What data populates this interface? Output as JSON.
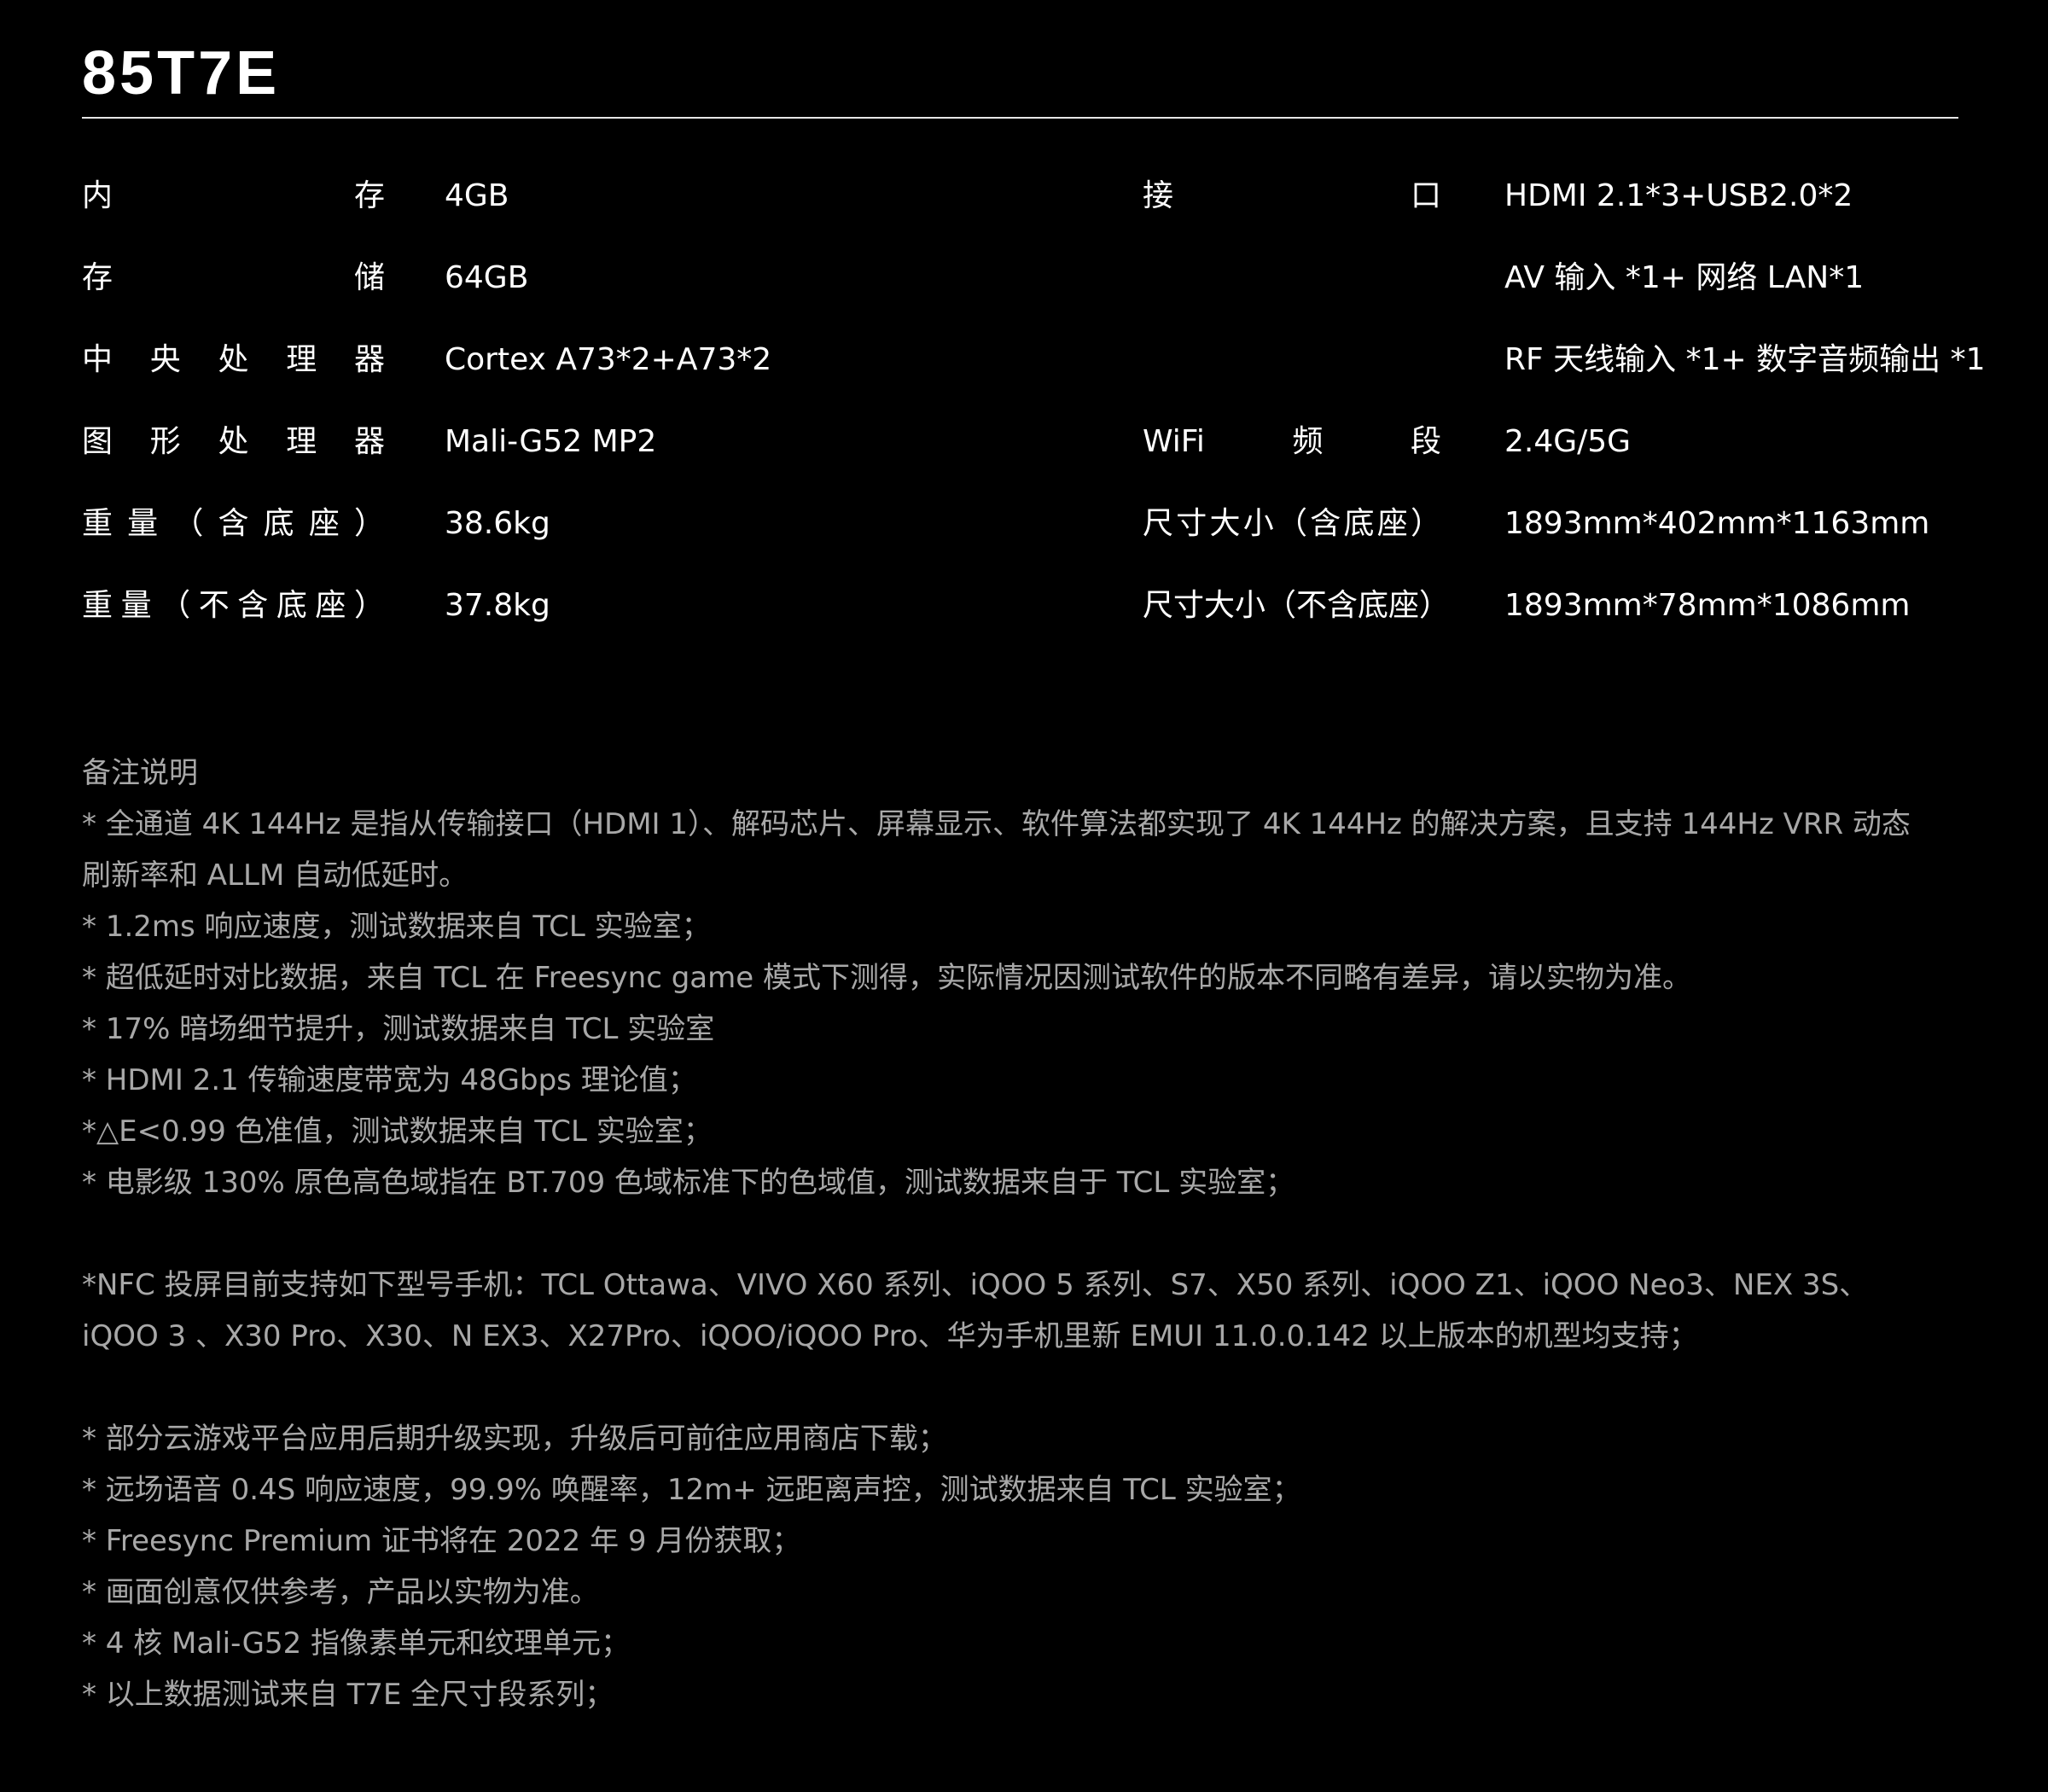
{
  "model": "85T7E",
  "specs_left": [
    {
      "label": "内存",
      "value": "4GB"
    },
    {
      "label": "存储",
      "value": "64GB"
    },
    {
      "label": "中央处理器",
      "value": "Cortex A73*2+A73*2"
    },
    {
      "label": "图形处理器",
      "value": "Mali-G52 MP2"
    },
    {
      "label": "重量（含底座）",
      "value": "38.6kg"
    },
    {
      "label": "重量（不含底座）",
      "value": "37.8kg"
    }
  ],
  "specs_right": [
    {
      "label": "接口",
      "value": "HDMI 2.1*3+USB2.0*2"
    },
    {
      "label": "",
      "value": "AV 输入 *1+ 网络 LAN*1"
    },
    {
      "label": "",
      "value": "RF 天线输入 *1+ 数字音频输出 *1"
    },
    {
      "label": "WiFi频段",
      "value": "2.4G/5G"
    },
    {
      "label": "尺寸大小（含底座）",
      "value": "1893mm*402mm*1163mm"
    },
    {
      "label": "尺寸大小（不含底座）",
      "value": "1893mm*78mm*1086mm"
    }
  ],
  "notes": {
    "heading": "备注说明",
    "group1": [
      "* 全通道 4K 144Hz 是指从传输接口（HDMI 1）、解码芯片、屏幕显示、软件算法都实现了 4K 144Hz 的解决方案，且支持 144Hz VRR 动态",
      "刷新率和 ALLM 自动低延时。",
      "* 1.2ms 响应速度，测试数据来自 TCL 实验室；",
      "* 超低延时对比数据，来自 TCL 在 Freesync game 模式下测得，实际情况因测试软件的版本不同略有差异，请以实物为准。",
      "* 17% 暗场细节提升，测试数据来自 TCL 实验室",
      "* HDMI 2.1 传输速度带宽为 48Gbps 理论值；",
      "*△E<0.99 色准值，测试数据来自 TCL 实验室；",
      "* 电影级 130% 原色高色域指在 BT.709 色域标准下的色域值，测试数据来自于 TCL 实验室；"
    ],
    "group2": [
      "*NFC 投屏目前支持如下型号手机：TCL Ottawa、VIVO X60 系列、iQOO 5 系列、S7、X50 系列、iQOO Z1、iQOO Neo3、NEX 3S、",
      "iQOO 3 、X30 Pro、X30、N EX3、X27Pro、iQOO/iQOO Pro、华为手机里新 EMUI 11.0.0.142 以上版本的机型均支持；"
    ],
    "group3": [
      "* 部分云游戏平台应用后期升级实现，升级后可前往应用商店下载；",
      "* 远场语音 0.4S 响应速度，99.9% 唤醒率，12m+ 远距离声控，测试数据来自 TCL 实验室；",
      "* Freesync Premium 证书将在 2022 年 9 月份获取；",
      "* 画面创意仅供参考，产品以实物为准。",
      "* 4 核 Mali-G52 指像素单元和纹理单元；",
      "* 以上数据测试来自 T7E 全尺寸段系列；"
    ]
  }
}
